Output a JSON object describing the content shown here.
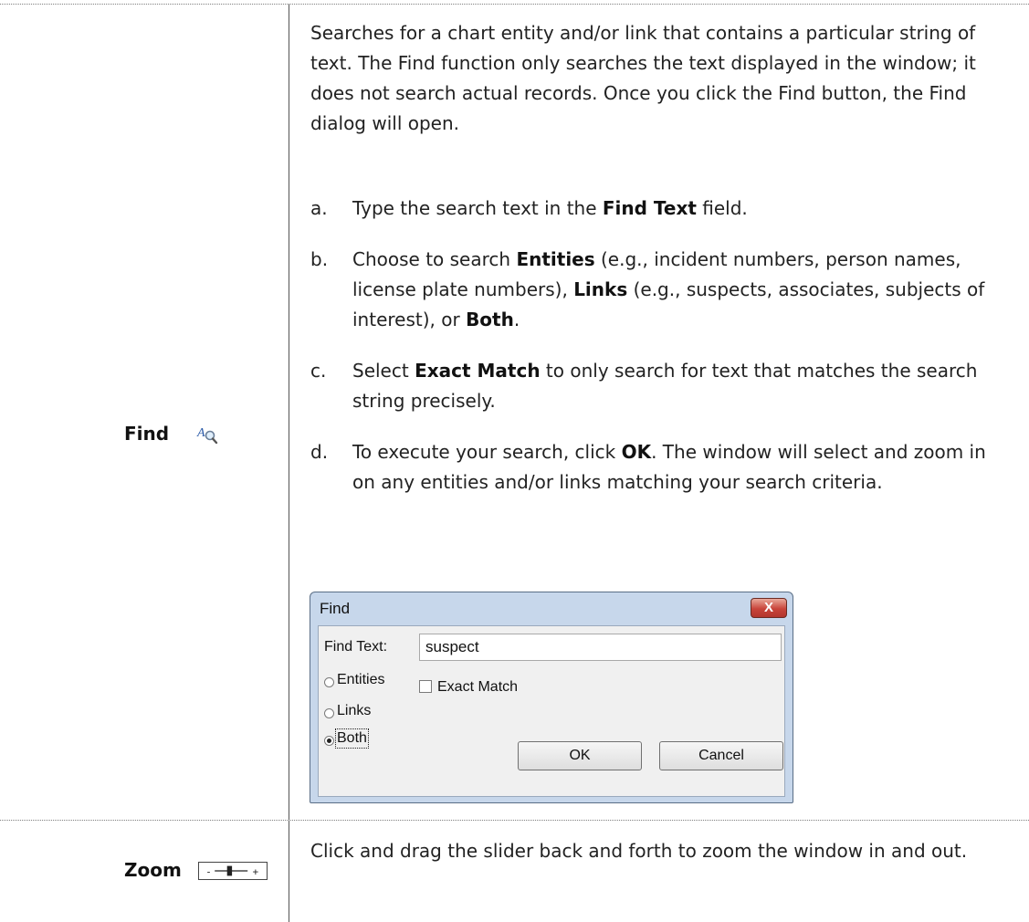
{
  "find_row": {
    "name": "Find",
    "icon": "find-icon",
    "description": "Searches for a chart entity and/or link that contains a particular string of text. The Find function only searches the text displayed in the window; it does not search actual records. Once you click the Find button, the Find dialog will open.",
    "steps": [
      {
        "letter": "a.",
        "pre": "Type the search text in the ",
        "bold1": "Find Text",
        "post": " field."
      },
      {
        "letter": "b.",
        "pre": "Choose to search ",
        "bold1": "Entities",
        "mid1": " (e.g., incident numbers, person names, license plate numbers), ",
        "bold2": "Links",
        "mid2": " (e.g., suspects, associates, subjects of interest), or ",
        "bold3": "Both",
        "post": "."
      },
      {
        "letter": "c.",
        "pre": "Select ",
        "bold1": "Exact Match",
        "post": " to only search for text that matches the search string precisely."
      },
      {
        "letter": "d.",
        "pre": "To execute your search, click ",
        "bold1": "OK",
        "post": ". The window will select and zoom in on any entities and/or links matching your search criteria."
      }
    ]
  },
  "dialog": {
    "title": "Find",
    "close_label": "X",
    "find_text_label": "Find Text:",
    "find_text_value": "suspect",
    "radio_entities": "Entities",
    "radio_links": "Links",
    "radio_both": "Both",
    "selected_radio": "Both",
    "exact_match_label": "Exact Match",
    "exact_match_checked": false,
    "ok_label": "OK",
    "cancel_label": "Cancel"
  },
  "zoom_row": {
    "name": "Zoom",
    "icon": "zoom-slider-icon",
    "description": "Click and drag the slider back and forth to zoom the window in and out."
  }
}
